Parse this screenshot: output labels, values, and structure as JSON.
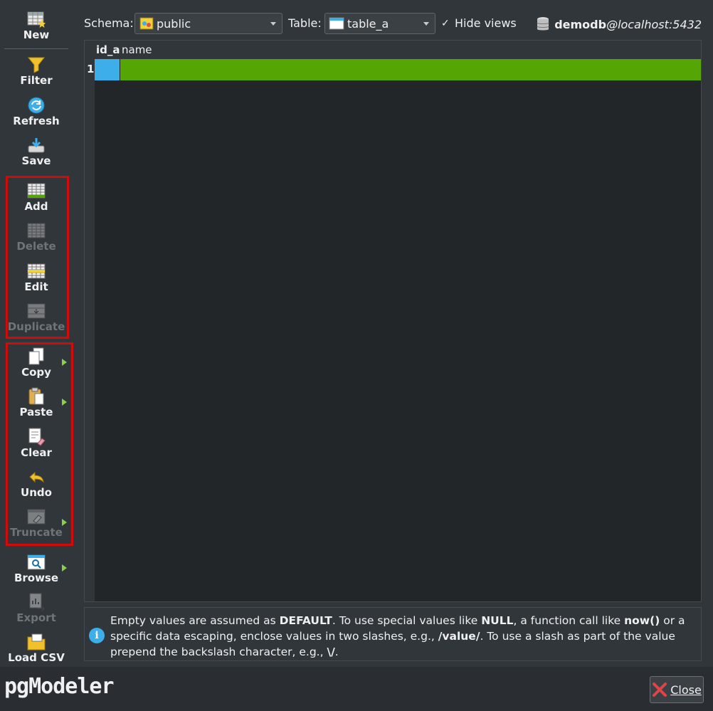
{
  "toolbar": {
    "new": "New",
    "filter": "Filter",
    "refresh": "Refresh",
    "save": "Save",
    "add": "Add",
    "delete": "Delete",
    "edit": "Edit",
    "duplicate": "Duplicate",
    "copy": "Copy",
    "paste": "Paste",
    "clear": "Clear",
    "undo": "Undo",
    "truncate": "Truncate",
    "browse": "Browse",
    "export": "Export",
    "load_csv": "Load CSV"
  },
  "topbar": {
    "schema_label": "Schema:",
    "schema_value": "public",
    "table_label": "Table:",
    "table_value": "table_a",
    "hide_views_label": "Hide views",
    "hide_views_checked": true,
    "db_name": "demodb",
    "db_host": "@localhost:5432"
  },
  "grid": {
    "columns": [
      "id_a",
      "name"
    ],
    "rows": [
      {
        "num": "1",
        "id_a": "",
        "name": ""
      }
    ],
    "colors": {
      "id_cell": "#3daee9",
      "name_cell": "#55a604"
    }
  },
  "info": {
    "p1": "Empty values are assumed as ",
    "b1": "DEFAULT",
    "p2": ". To use special values like ",
    "b2": "NULL",
    "p3": ", a function call like ",
    "b3": "now()",
    "p4": " or a specific data escaping, enclose values in two slashes, e.g., ",
    "b4": "/value/",
    "p5": ". To use a slash as part of the value prepend the backslash character, e.g., ",
    "b5": "\\/",
    "p6": "."
  },
  "footer": {
    "logo": "pgModeler",
    "close_label": "Close"
  }
}
